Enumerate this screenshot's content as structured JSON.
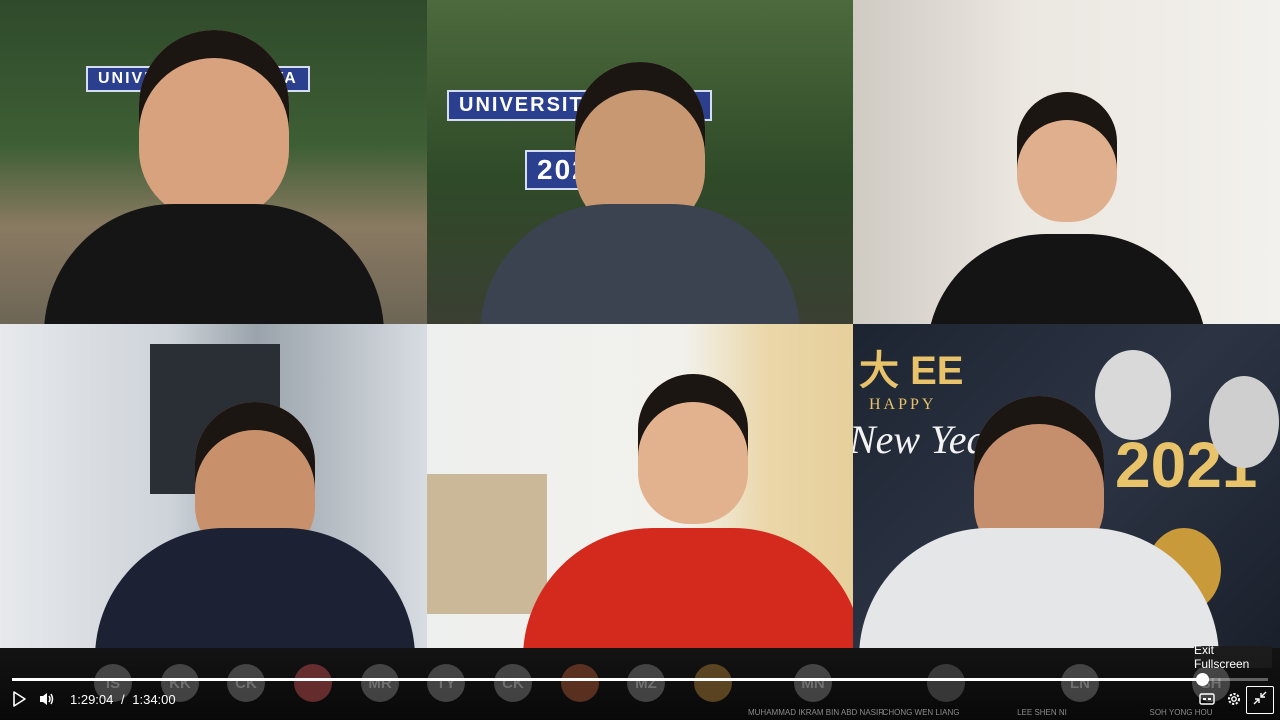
{
  "video": {
    "current_time": "1:29:04",
    "separator": "/",
    "duration": "1:34:00",
    "progress": 0.9475
  },
  "tiles": [
    {
      "id": "tile-1",
      "sign_top": "UNIVERSITY MALAYA"
    },
    {
      "id": "tile-2",
      "sign_top": "UNIVERSITY MALAYA",
      "sign_year": "2020"
    },
    {
      "id": "tile-3"
    },
    {
      "id": "tile-4"
    },
    {
      "id": "tile-5"
    },
    {
      "id": "tile-6",
      "banner_chars": "大 EE",
      "happy": "HAPPY",
      "new_year": "New Year",
      "year": "2021"
    }
  ],
  "participants": [
    {
      "initials": "IS"
    },
    {
      "initials": "KK"
    },
    {
      "initials": "CK"
    },
    {
      "initials": ""
    },
    {
      "initials": "MR"
    },
    {
      "initials": "TY"
    },
    {
      "initials": "CK"
    },
    {
      "initials": ""
    },
    {
      "initials": "MZ"
    },
    {
      "initials": ""
    },
    {
      "initials": "MN",
      "name": "MUHAMMAD IKRAM BIN ABD NASIR"
    },
    {
      "initials": "",
      "name": "CHONG WEN LIANG"
    },
    {
      "initials": "LN",
      "name": "LEE SHEN NI"
    },
    {
      "initials": "SH",
      "name": "SOH YONG HOU"
    }
  ],
  "tooltip": {
    "label": "Exit Fullscreen"
  },
  "icons": {
    "play": "play-icon",
    "volume": "volume-icon",
    "captions": "captions-icon",
    "settings": "gear-icon",
    "exit_fullscreen": "exit-fullscreen-icon"
  },
  "colors": {
    "progress": "#ffffff",
    "bar_bg": "#0e0e0e"
  }
}
